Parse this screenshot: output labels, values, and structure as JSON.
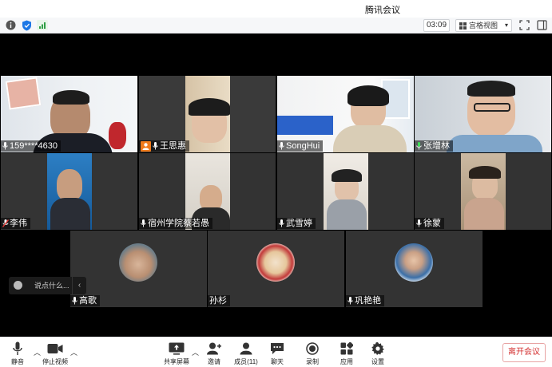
{
  "window": {
    "title": "腾讯会议"
  },
  "toolbar": {
    "info_icon": "info-icon",
    "shield_icon": "shield-icon",
    "signal_icon": "signal-icon",
    "timer": "03:09",
    "view_mode": "宫格视图",
    "fullscreen_icon": "fullscreen-icon",
    "sidebar_icon": "sidebar-toggle-icon"
  },
  "participants": [
    {
      "name": "159****4630",
      "mic": "on"
    },
    {
      "name": "王思惠",
      "mic": "on",
      "host": true
    },
    {
      "name": "SongHui",
      "mic": "on"
    },
    {
      "name": "张增林",
      "mic": "speaking"
    },
    {
      "name": "李伟",
      "mic": "muted"
    },
    {
      "name": "宿州学院蔡若愚",
      "mic": "on"
    },
    {
      "name": "武雪婷",
      "mic": "on"
    },
    {
      "name": "徐蒙",
      "mic": "on"
    },
    {
      "name": "高歌",
      "mic": "on"
    },
    {
      "name": "孙杉",
      "mic": "none"
    },
    {
      "name": "巩艳艳",
      "mic": "on"
    }
  ],
  "chat": {
    "placeholder": "说点什么..."
  },
  "controls": {
    "mute": "静音",
    "stop_video": "停止视频",
    "share_screen": "共享屏幕",
    "invite": "邀请",
    "members": "成员(11)",
    "chat": "聊天",
    "record": "录制",
    "apps": "应用",
    "settings": "设置",
    "leave": "离开会议"
  },
  "colors": {
    "leave": "#d32f2f",
    "speaking_mic": "#3ddc57",
    "muted_mic": "#e53935",
    "host_badge": "#f07a1a"
  }
}
